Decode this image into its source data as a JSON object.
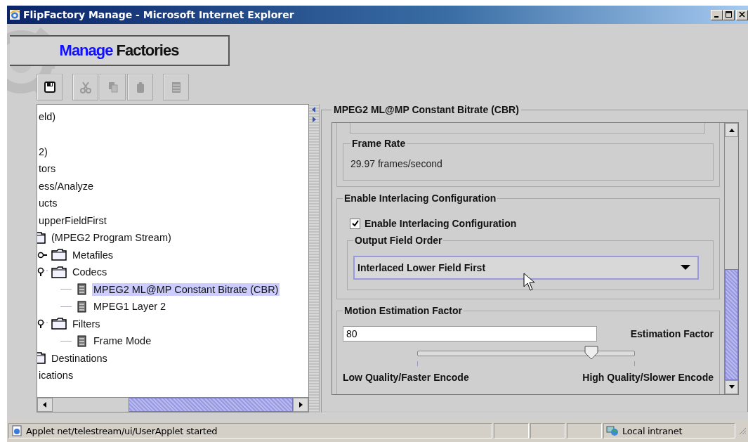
{
  "window": {
    "title": "FlipFactory Manage - Microsoft Internet Explorer"
  },
  "header": {
    "highlight": "Manage",
    "rest": "Factories"
  },
  "toolbar": [
    [
      {
        "kind": "save",
        "disabled": false
      }
    ],
    [
      {
        "kind": "cut",
        "disabled": true
      },
      {
        "kind": "copy",
        "disabled": true
      },
      {
        "kind": "paste",
        "disabled": true
      }
    ],
    [
      {
        "kind": "list",
        "disabled": true
      }
    ]
  ],
  "tree": {
    "items": [
      {
        "label": "eld)",
        "kind": "text"
      },
      {
        "label": "2)",
        "kind": "text"
      },
      {
        "label": "tors",
        "kind": "text"
      },
      {
        "label": "ess/Analyze",
        "kind": "text"
      },
      {
        "label": "ucts",
        "kind": "text"
      },
      {
        "label": "upperFieldFirst",
        "kind": "text"
      },
      {
        "label": "(MPEG2 Program Stream)",
        "kind": "folder",
        "children": [
          {
            "label": "Metafiles",
            "kind": "folder",
            "expanded": false
          },
          {
            "label": "Codecs",
            "kind": "folder",
            "expanded": true,
            "children": [
              {
                "label": "MPEG2 ML@MP Constant Bitrate (CBR)",
                "kind": "leaf",
                "selected": true
              },
              {
                "label": "MPEG1 Layer 2",
                "kind": "leaf",
                "selected": false
              }
            ]
          },
          {
            "label": "Filters",
            "kind": "folder",
            "expanded": true,
            "children": [
              {
                "label": "Frame Mode",
                "kind": "leaf",
                "selected": false
              }
            ]
          }
        ]
      },
      {
        "label": "Destinations",
        "kind": "folder"
      },
      {
        "label": "ications",
        "kind": "text"
      }
    ]
  },
  "panel": {
    "title": "MPEG2 ML@MP Constant Bitrate (CBR)",
    "frame_rate": {
      "label": "Frame Rate",
      "value": "29.97 frames/second"
    },
    "interlacing": {
      "title": "Enable Interlacing Configuration",
      "checkbox": {
        "label": "Enable Interlacing Configuration",
        "checked": true
      },
      "field_order": {
        "label": "Output Field Order",
        "value": "Interlaced Lower Field First"
      }
    },
    "motion": {
      "title": "Motion Estimation Factor",
      "value": "80",
      "label": "Estimation Factor",
      "level": 0.8,
      "min_label": "Low Quality/Faster Encode",
      "max_label": "High Quality/Slower Encode"
    }
  },
  "status_bar": {
    "text": "Applet net/telestream/ui/UserApplet started",
    "zone": "Local intranet"
  }
}
